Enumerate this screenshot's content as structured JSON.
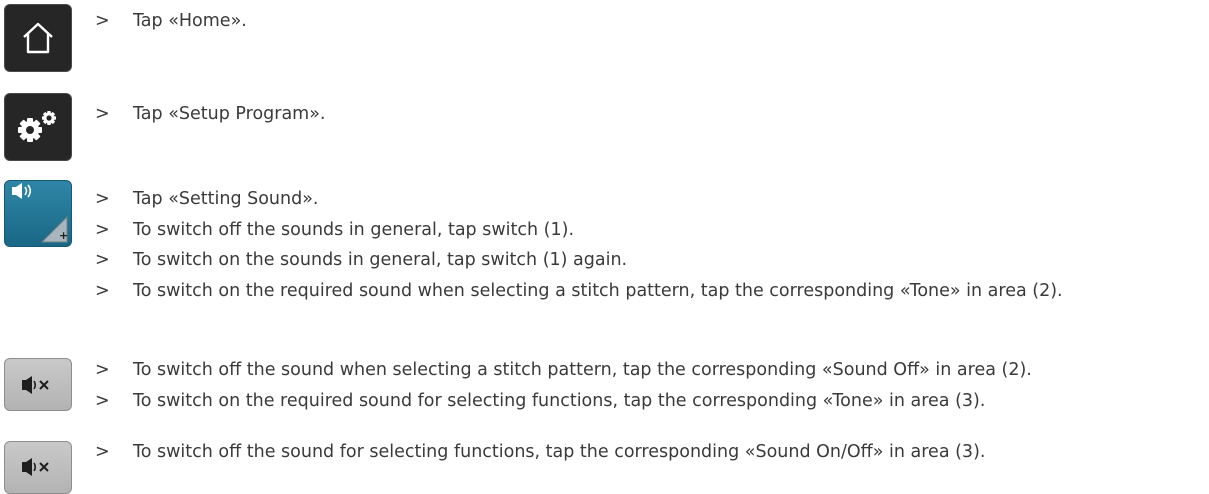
{
  "bullet": ">",
  "icons": {
    "home": "home-icon",
    "setup": "gears-icon",
    "sound_setting": "speaker-icon",
    "sound_off": "speaker-mute-icon"
  },
  "colors": {
    "dark_button": "#262626",
    "teal_button": "#1f7596",
    "grey_button": "#bdbdbd",
    "text": "#3a3a3a"
  },
  "steps": [
    "Tap «Home».",
    "Tap «Setup Program».",
    "Tap «Setting Sound».",
    "To switch off the sounds in general, tap switch (1).",
    "To switch on the sounds in general, tap switch (1) again.",
    "To switch on the required sound when selecting a stitch pattern, tap the corresponding «Tone» in area (2).",
    "To switch off the sound when selecting a stitch pattern, tap the corresponding «Sound Off» in area (2).",
    "To switch on the required sound for selecting functions, tap the corresponding «Tone» in area (3).",
    "To switch off the sound for selecting functions, tap the corresponding «Sound On/Off» in area (3)."
  ]
}
